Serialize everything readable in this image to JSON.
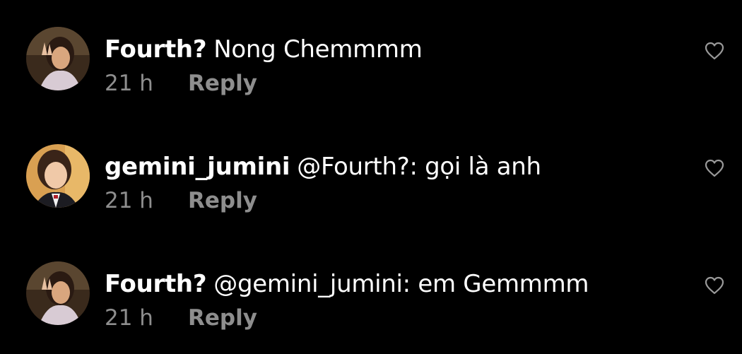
{
  "colors": {
    "background": "#000000",
    "primary_text": "#ffffff",
    "secondary_text": "#8e8e8e",
    "like_icon": "#9a9a9a"
  },
  "comments": [
    {
      "username": "Fourth?",
      "text": "Nong Chemmmm",
      "time": "21 h",
      "reply_label": "Reply",
      "like_icon": "heart-outline-icon",
      "avatar": "avatar-photo"
    },
    {
      "username": "gemini_jumini",
      "text": "@Fourth?: gọi là anh",
      "time": "21 h",
      "reply_label": "Reply",
      "like_icon": "heart-outline-icon",
      "avatar": "avatar-photo"
    },
    {
      "username": "Fourth?",
      "text": "@gemini_jumini: em Gemmmm",
      "time": "21 h",
      "reply_label": "Reply",
      "like_icon": "heart-outline-icon",
      "avatar": "avatar-photo"
    }
  ]
}
